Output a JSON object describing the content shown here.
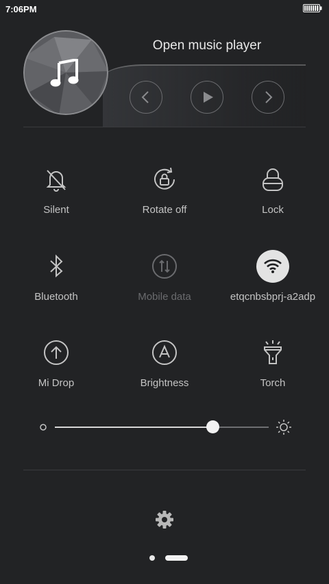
{
  "status_bar": {
    "time": "7:06PM",
    "battery_level": 1.0
  },
  "music": {
    "title": "Open music player",
    "album_icon": "music-note-icon",
    "controls": [
      {
        "name": "previous-button",
        "icon": "chevron-left-icon"
      },
      {
        "name": "play-button",
        "icon": "play-icon"
      },
      {
        "name": "next-button",
        "icon": "chevron-right-icon"
      }
    ]
  },
  "toggles": [
    {
      "id": "silent",
      "label": "Silent",
      "icon": "bell-off-icon",
      "active": false,
      "enabled": true
    },
    {
      "id": "rotate",
      "label": "Rotate off",
      "icon": "rotate-lock-icon",
      "active": false,
      "enabled": true
    },
    {
      "id": "lock",
      "label": "Lock",
      "icon": "lock-icon",
      "active": false,
      "enabled": true
    },
    {
      "id": "bluetooth",
      "label": "Bluetooth",
      "icon": "bluetooth-icon",
      "active": false,
      "enabled": true
    },
    {
      "id": "mobile-data",
      "label": "Mobile data",
      "icon": "mobile-data-icon",
      "active": false,
      "enabled": false
    },
    {
      "id": "wifi",
      "label": "etqcnbsbprj-a2adp",
      "icon": "wifi-icon",
      "active": true,
      "enabled": true
    },
    {
      "id": "mi-drop",
      "label": "Mi Drop",
      "icon": "upload-arrow-icon",
      "active": false,
      "enabled": true
    },
    {
      "id": "brightness",
      "label": "Brightness",
      "icon": "auto-brightness-icon",
      "active": false,
      "enabled": true
    },
    {
      "id": "torch",
      "label": "Torch",
      "icon": "flashlight-icon",
      "active": false,
      "enabled": true
    }
  ],
  "brightness_slider": {
    "value": 0.74,
    "min_icon": "dim-circle-icon",
    "max_icon": "sun-icon"
  },
  "footer": {
    "settings_icon": "gear-icon",
    "pages": 2,
    "current_page": 2
  },
  "colors": {
    "background": "#222325",
    "text": "#c4c4c4",
    "active": "#e3e3e3",
    "disabled": "#6a6b6e"
  }
}
